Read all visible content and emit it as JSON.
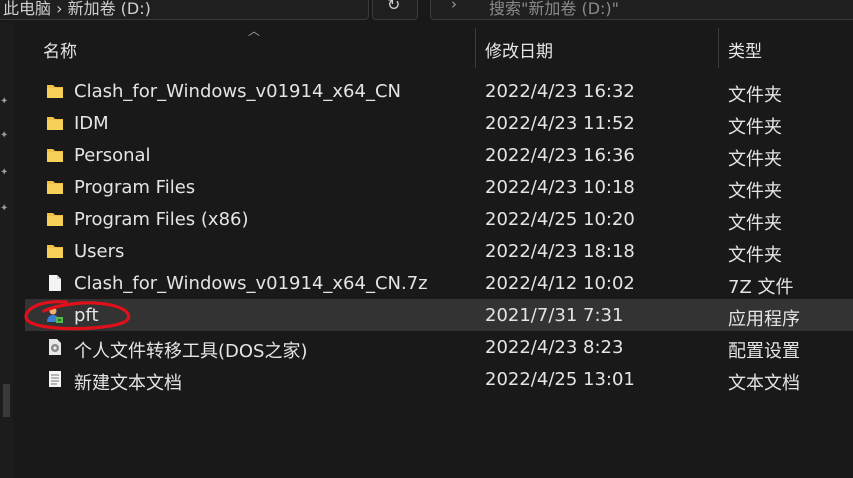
{
  "address": {
    "text": "此电脑 › 新加卷 (D:)"
  },
  "search": {
    "placeholder": "搜索\"新加卷 (D:)\""
  },
  "columns": {
    "name": "名称",
    "date": "修改日期",
    "type": "类型"
  },
  "files": [
    {
      "icon": "folder-icon",
      "name": "Clash_for_Windows_v01914_x64_CN",
      "date": "2022/4/23 16:32",
      "type": "文件夹"
    },
    {
      "icon": "folder-icon",
      "name": "IDM",
      "date": "2022/4/23 11:52",
      "type": "文件夹"
    },
    {
      "icon": "folder-icon",
      "name": "Personal",
      "date": "2022/4/23 16:36",
      "type": "文件夹"
    },
    {
      "icon": "folder-icon",
      "name": "Program Files",
      "date": "2022/4/23 10:18",
      "type": "文件夹"
    },
    {
      "icon": "folder-icon",
      "name": "Program Files (x86)",
      "date": "2022/4/25 10:20",
      "type": "文件夹"
    },
    {
      "icon": "folder-icon",
      "name": "Users",
      "date": "2022/4/23 18:18",
      "type": "文件夹"
    },
    {
      "icon": "file-icon",
      "name": "Clash_for_Windows_v01914_x64_CN.7z",
      "date": "2022/4/12 10:02",
      "type": "7Z 文件"
    },
    {
      "icon": "application-icon",
      "name": "pft",
      "date": "2021/7/31 7:31",
      "type": "应用程序"
    },
    {
      "icon": "settings-file-icon",
      "name": "个人文件转移工具(DOS之家)",
      "date": "2022/4/23 8:23",
      "type": "配置设置"
    },
    {
      "icon": "text-document-icon",
      "name": "新建文本文档",
      "date": "2022/4/25 13:01",
      "type": "文本文档"
    }
  ],
  "colors": {
    "background": "#191919",
    "selected_row": "#333333",
    "folder": "#f2c144",
    "annotation": "#e0101a"
  }
}
